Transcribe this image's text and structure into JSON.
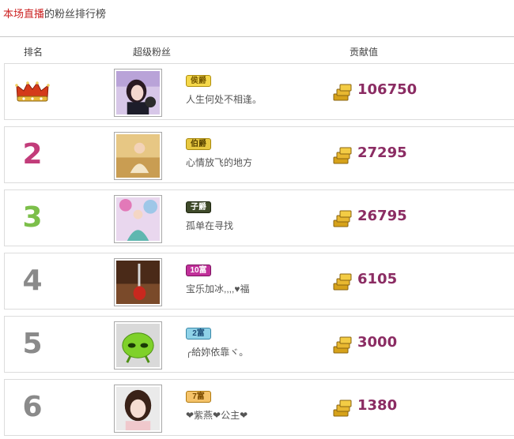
{
  "header": {
    "title_highlight": "本场直播",
    "title_rest": "的粉丝排行榜"
  },
  "columns": {
    "rank": "排名",
    "fan": "超级粉丝",
    "value": "贡献值"
  },
  "rows": [
    {
      "rank": "1",
      "rank_icon": "crown-icon",
      "badge": "侯爵",
      "badge_color": "#7a5c00",
      "badge_bg": "#f5d84a",
      "nickname": "人生何处不相逢。",
      "value": "106750"
    },
    {
      "rank": "2",
      "badge": "伯爵",
      "badge_color": "#5a4400",
      "badge_bg": "#e8c840",
      "nickname": "心情放飞的地方",
      "value": "27295"
    },
    {
      "rank": "3",
      "badge": "子爵",
      "badge_color": "#fff",
      "badge_bg": "#3f4a2a",
      "nickname": "孤单在寻找",
      "value": "26795"
    },
    {
      "rank": "4",
      "badge": "10富",
      "badge_color": "#fff",
      "badge_bg": "#c1309a",
      "nickname": "宝乐加冰,,,,♥福",
      "value": "6105"
    },
    {
      "rank": "5",
      "badge": "2富",
      "badge_color": "#1f4f7a",
      "badge_bg": "#8fd2e8",
      "nickname": "╭給妳依靠ヾ。",
      "value": "3000"
    },
    {
      "rank": "6",
      "badge": "7富",
      "badge_color": "#7a4a00",
      "badge_bg": "#f5c36a",
      "nickname": "❤紫燕❤公主❤",
      "value": "1380"
    }
  ],
  "colors": {
    "value_text": "#8b2c63",
    "title_highlight": "#cc2222"
  }
}
